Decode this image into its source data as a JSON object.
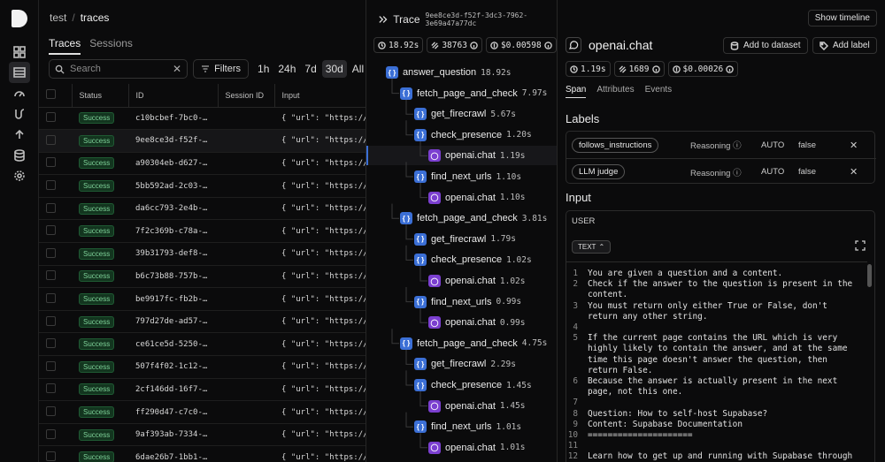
{
  "breadcrumb": {
    "project": "test",
    "separator": "/",
    "page": "traces"
  },
  "view_tabs": [
    {
      "label": "Traces",
      "active": true
    },
    {
      "label": "Sessions",
      "active": false
    }
  ],
  "search": {
    "placeholder": "Search",
    "clear": "✕"
  },
  "filters_label": "Filters",
  "ranges": [
    {
      "label": "1h"
    },
    {
      "label": "24h"
    },
    {
      "label": "7d"
    },
    {
      "label": "30d",
      "active": true
    },
    {
      "label": "All"
    }
  ],
  "table": {
    "columns": [
      "Status",
      "ID",
      "Session ID",
      "Input"
    ],
    "rows": [
      {
        "status": "Success",
        "id": "c10bcbef-7bc0-…",
        "input": "{ \"url\": \"https://s…"
      },
      {
        "status": "Success",
        "id": "9ee8ce3d-f52f-…",
        "input": "{ \"url\": \"https://s…",
        "selected": true
      },
      {
        "status": "Success",
        "id": "a90304eb-d627-…",
        "input": "{ \"url\": \"https://s…"
      },
      {
        "status": "Success",
        "id": "5bb592ad-2c03-…",
        "input": "{ \"url\": \"https://s…"
      },
      {
        "status": "Success",
        "id": "da6cc793-2e4b-…",
        "input": "{ \"url\": \"https://s…"
      },
      {
        "status": "Success",
        "id": "7f2c369b-c78a-…",
        "input": "{ \"url\": \"https://s…"
      },
      {
        "status": "Success",
        "id": "39b31793-def8-…",
        "input": "{ \"url\": \"https://s…"
      },
      {
        "status": "Success",
        "id": "b6c73b88-757b-…",
        "input": "{ \"url\": \"https://s…"
      },
      {
        "status": "Success",
        "id": "be9917fc-fb2b-…",
        "input": "{ \"url\": \"https://s…"
      },
      {
        "status": "Success",
        "id": "797d27de-ad57-…",
        "input": "{ \"url\": \"https://s…"
      },
      {
        "status": "Success",
        "id": "ce61ce5d-5250-…",
        "input": "{ \"url\": \"https://s…"
      },
      {
        "status": "Success",
        "id": "507f4f02-1c12-…",
        "input": "{ \"url\": \"https://s…"
      },
      {
        "status": "Success",
        "id": "2cf146dd-16f7-…",
        "input": "{ \"url\": \"https://s…"
      },
      {
        "status": "Success",
        "id": "ff290d47-c7c0-…",
        "input": "{ \"url\": \"https://s…"
      },
      {
        "status": "Success",
        "id": "9af393ab-7334-…",
        "input": "{ \"url\": \"https://s…"
      },
      {
        "status": "Success",
        "id": "6dae26b7-1bb1-…",
        "input": "{ \"url\": \"https://s…"
      }
    ]
  },
  "trace": {
    "title": "Trace",
    "id": "9ee8ce3d-f52f-3dc3-7962-3e69a47a77dc",
    "metrics": {
      "duration": "18.92s",
      "tokens": "38763",
      "cost": "$0.00598"
    },
    "nodes": [
      {
        "name": "answer_question",
        "dur": "18.92s",
        "kind": "fn",
        "depth": 0
      },
      {
        "name": "fetch_page_and_check",
        "dur": "7.97s",
        "kind": "fn",
        "depth": 1
      },
      {
        "name": "get_firecrawl",
        "dur": "5.67s",
        "kind": "fn",
        "depth": 2
      },
      {
        "name": "check_presence",
        "dur": "1.20s",
        "kind": "fn",
        "depth": 2
      },
      {
        "name": "openai.chat",
        "dur": "1.19s",
        "kind": "gen",
        "depth": 3,
        "selected": true
      },
      {
        "name": "find_next_urls",
        "dur": "1.10s",
        "kind": "fn",
        "depth": 2
      },
      {
        "name": "openai.chat",
        "dur": "1.10s",
        "kind": "gen",
        "depth": 3
      },
      {
        "name": "fetch_page_and_check",
        "dur": "3.81s",
        "kind": "fn",
        "depth": 1
      },
      {
        "name": "get_firecrawl",
        "dur": "1.79s",
        "kind": "fn",
        "depth": 2
      },
      {
        "name": "check_presence",
        "dur": "1.02s",
        "kind": "fn",
        "depth": 2
      },
      {
        "name": "openai.chat",
        "dur": "1.02s",
        "kind": "gen",
        "depth": 3
      },
      {
        "name": "find_next_urls",
        "dur": "0.99s",
        "kind": "fn",
        "depth": 2
      },
      {
        "name": "openai.chat",
        "dur": "0.99s",
        "kind": "gen",
        "depth": 3
      },
      {
        "name": "fetch_page_and_check",
        "dur": "4.75s",
        "kind": "fn",
        "depth": 1
      },
      {
        "name": "get_firecrawl",
        "dur": "2.29s",
        "kind": "fn",
        "depth": 2
      },
      {
        "name": "check_presence",
        "dur": "1.45s",
        "kind": "fn",
        "depth": 2
      },
      {
        "name": "openai.chat",
        "dur": "1.45s",
        "kind": "gen",
        "depth": 3
      },
      {
        "name": "find_next_urls",
        "dur": "1.01s",
        "kind": "fn",
        "depth": 2
      },
      {
        "name": "openai.chat",
        "dur": "1.01s",
        "kind": "gen",
        "depth": 3
      }
    ]
  },
  "detail": {
    "show_timeline": "Show timeline",
    "span_name": "openai.chat",
    "add_dataset": "Add to dataset",
    "add_label": "Add label",
    "metrics": {
      "duration": "1.19s",
      "tokens": "1689",
      "cost": "$0.00026"
    },
    "tabs": [
      {
        "label": "Span",
        "active": true
      },
      {
        "label": "Attributes"
      },
      {
        "label": "Events"
      }
    ],
    "labels_title": "Labels",
    "labels": [
      {
        "name": "follows_instructions",
        "reasoning": "Reasoning",
        "source": "AUTO",
        "value": "false",
        "remove": "✕"
      },
      {
        "name": "LLM judge",
        "reasoning": "Reasoning",
        "source": "AUTO",
        "value": "false",
        "remove": "✕"
      }
    ],
    "input_title": "Input",
    "role": "USER",
    "format": "TEXT",
    "lines": [
      {
        "n": "1",
        "t": "You are given a question and a content."
      },
      {
        "n": "2",
        "t": "Check if the answer to the question is present in the content."
      },
      {
        "n": "3",
        "t": "You must return only either True or False, don't return any other string."
      },
      {
        "n": "4",
        "t": ""
      },
      {
        "n": "5",
        "t": "If the current page contains the URL which is very highly likely to contain the answer, and at the same time this page doesn't answer the question, then return False."
      },
      {
        "n": "6",
        "t": "Because the answer is actually present in the next page, not this one."
      },
      {
        "n": "7",
        "t": ""
      },
      {
        "n": "8",
        "t": "Question: How to self-host Supabase?"
      },
      {
        "n": "9",
        "t": "Content: Supabase Documentation"
      },
      {
        "n": "10",
        "t": "====================="
      },
      {
        "n": "11",
        "t": ""
      },
      {
        "n": "12",
        "t": "Learn how to get up and running with Supabase through"
      }
    ]
  }
}
